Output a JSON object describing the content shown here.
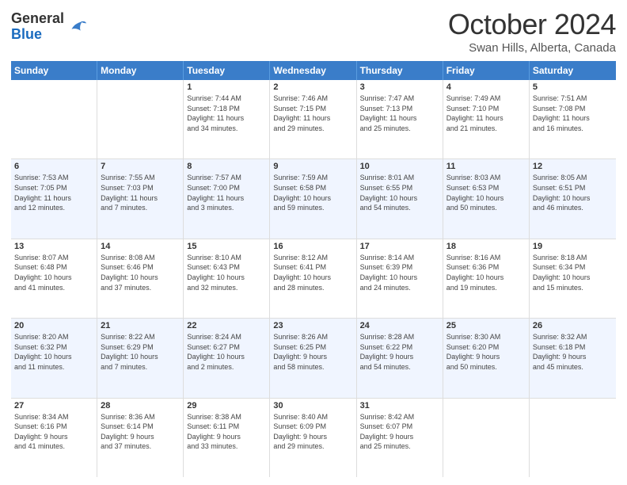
{
  "header": {
    "logo_general": "General",
    "logo_blue": "Blue",
    "month_title": "October 2024",
    "location": "Swan Hills, Alberta, Canada"
  },
  "days_of_week": [
    "Sunday",
    "Monday",
    "Tuesday",
    "Wednesday",
    "Thursday",
    "Friday",
    "Saturday"
  ],
  "weeks": [
    {
      "alt": false,
      "cells": [
        {
          "day": "",
          "lines": []
        },
        {
          "day": "",
          "lines": []
        },
        {
          "day": "1",
          "lines": [
            "Sunrise: 7:44 AM",
            "Sunset: 7:18 PM",
            "Daylight: 11 hours",
            "and 34 minutes."
          ]
        },
        {
          "day": "2",
          "lines": [
            "Sunrise: 7:46 AM",
            "Sunset: 7:15 PM",
            "Daylight: 11 hours",
            "and 29 minutes."
          ]
        },
        {
          "day": "3",
          "lines": [
            "Sunrise: 7:47 AM",
            "Sunset: 7:13 PM",
            "Daylight: 11 hours",
            "and 25 minutes."
          ]
        },
        {
          "day": "4",
          "lines": [
            "Sunrise: 7:49 AM",
            "Sunset: 7:10 PM",
            "Daylight: 11 hours",
            "and 21 minutes."
          ]
        },
        {
          "day": "5",
          "lines": [
            "Sunrise: 7:51 AM",
            "Sunset: 7:08 PM",
            "Daylight: 11 hours",
            "and 16 minutes."
          ]
        }
      ]
    },
    {
      "alt": true,
      "cells": [
        {
          "day": "6",
          "lines": [
            "Sunrise: 7:53 AM",
            "Sunset: 7:05 PM",
            "Daylight: 11 hours",
            "and 12 minutes."
          ]
        },
        {
          "day": "7",
          "lines": [
            "Sunrise: 7:55 AM",
            "Sunset: 7:03 PM",
            "Daylight: 11 hours",
            "and 7 minutes."
          ]
        },
        {
          "day": "8",
          "lines": [
            "Sunrise: 7:57 AM",
            "Sunset: 7:00 PM",
            "Daylight: 11 hours",
            "and 3 minutes."
          ]
        },
        {
          "day": "9",
          "lines": [
            "Sunrise: 7:59 AM",
            "Sunset: 6:58 PM",
            "Daylight: 10 hours",
            "and 59 minutes."
          ]
        },
        {
          "day": "10",
          "lines": [
            "Sunrise: 8:01 AM",
            "Sunset: 6:55 PM",
            "Daylight: 10 hours",
            "and 54 minutes."
          ]
        },
        {
          "day": "11",
          "lines": [
            "Sunrise: 8:03 AM",
            "Sunset: 6:53 PM",
            "Daylight: 10 hours",
            "and 50 minutes."
          ]
        },
        {
          "day": "12",
          "lines": [
            "Sunrise: 8:05 AM",
            "Sunset: 6:51 PM",
            "Daylight: 10 hours",
            "and 46 minutes."
          ]
        }
      ]
    },
    {
      "alt": false,
      "cells": [
        {
          "day": "13",
          "lines": [
            "Sunrise: 8:07 AM",
            "Sunset: 6:48 PM",
            "Daylight: 10 hours",
            "and 41 minutes."
          ]
        },
        {
          "day": "14",
          "lines": [
            "Sunrise: 8:08 AM",
            "Sunset: 6:46 PM",
            "Daylight: 10 hours",
            "and 37 minutes."
          ]
        },
        {
          "day": "15",
          "lines": [
            "Sunrise: 8:10 AM",
            "Sunset: 6:43 PM",
            "Daylight: 10 hours",
            "and 32 minutes."
          ]
        },
        {
          "day": "16",
          "lines": [
            "Sunrise: 8:12 AM",
            "Sunset: 6:41 PM",
            "Daylight: 10 hours",
            "and 28 minutes."
          ]
        },
        {
          "day": "17",
          "lines": [
            "Sunrise: 8:14 AM",
            "Sunset: 6:39 PM",
            "Daylight: 10 hours",
            "and 24 minutes."
          ]
        },
        {
          "day": "18",
          "lines": [
            "Sunrise: 8:16 AM",
            "Sunset: 6:36 PM",
            "Daylight: 10 hours",
            "and 19 minutes."
          ]
        },
        {
          "day": "19",
          "lines": [
            "Sunrise: 8:18 AM",
            "Sunset: 6:34 PM",
            "Daylight: 10 hours",
            "and 15 minutes."
          ]
        }
      ]
    },
    {
      "alt": true,
      "cells": [
        {
          "day": "20",
          "lines": [
            "Sunrise: 8:20 AM",
            "Sunset: 6:32 PM",
            "Daylight: 10 hours",
            "and 11 minutes."
          ]
        },
        {
          "day": "21",
          "lines": [
            "Sunrise: 8:22 AM",
            "Sunset: 6:29 PM",
            "Daylight: 10 hours",
            "and 7 minutes."
          ]
        },
        {
          "day": "22",
          "lines": [
            "Sunrise: 8:24 AM",
            "Sunset: 6:27 PM",
            "Daylight: 10 hours",
            "and 2 minutes."
          ]
        },
        {
          "day": "23",
          "lines": [
            "Sunrise: 8:26 AM",
            "Sunset: 6:25 PM",
            "Daylight: 9 hours",
            "and 58 minutes."
          ]
        },
        {
          "day": "24",
          "lines": [
            "Sunrise: 8:28 AM",
            "Sunset: 6:22 PM",
            "Daylight: 9 hours",
            "and 54 minutes."
          ]
        },
        {
          "day": "25",
          "lines": [
            "Sunrise: 8:30 AM",
            "Sunset: 6:20 PM",
            "Daylight: 9 hours",
            "and 50 minutes."
          ]
        },
        {
          "day": "26",
          "lines": [
            "Sunrise: 8:32 AM",
            "Sunset: 6:18 PM",
            "Daylight: 9 hours",
            "and 45 minutes."
          ]
        }
      ]
    },
    {
      "alt": false,
      "cells": [
        {
          "day": "27",
          "lines": [
            "Sunrise: 8:34 AM",
            "Sunset: 6:16 PM",
            "Daylight: 9 hours",
            "and 41 minutes."
          ]
        },
        {
          "day": "28",
          "lines": [
            "Sunrise: 8:36 AM",
            "Sunset: 6:14 PM",
            "Daylight: 9 hours",
            "and 37 minutes."
          ]
        },
        {
          "day": "29",
          "lines": [
            "Sunrise: 8:38 AM",
            "Sunset: 6:11 PM",
            "Daylight: 9 hours",
            "and 33 minutes."
          ]
        },
        {
          "day": "30",
          "lines": [
            "Sunrise: 8:40 AM",
            "Sunset: 6:09 PM",
            "Daylight: 9 hours",
            "and 29 minutes."
          ]
        },
        {
          "day": "31",
          "lines": [
            "Sunrise: 8:42 AM",
            "Sunset: 6:07 PM",
            "Daylight: 9 hours",
            "and 25 minutes."
          ]
        },
        {
          "day": "",
          "lines": []
        },
        {
          "day": "",
          "lines": []
        }
      ]
    }
  ]
}
